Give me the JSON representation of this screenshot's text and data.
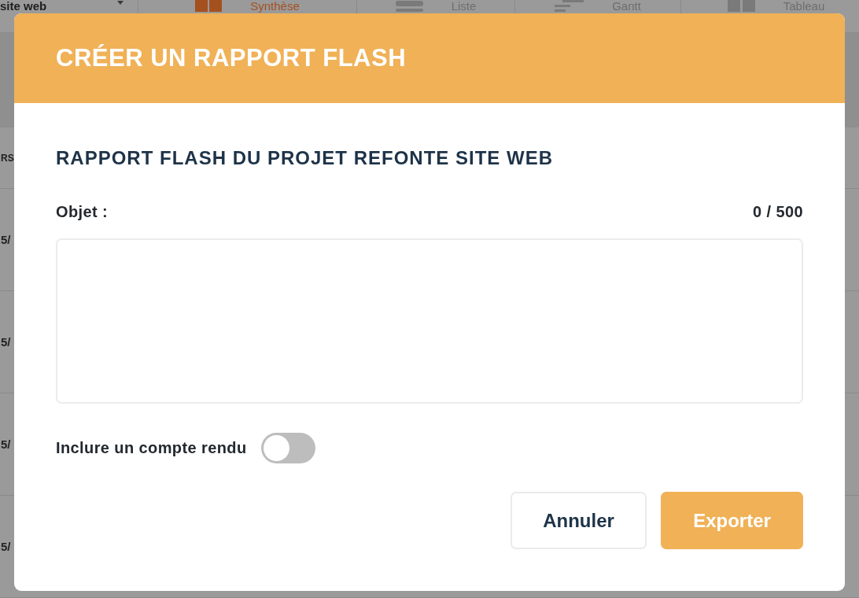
{
  "background": {
    "project_selector": {
      "value": "site web"
    },
    "views": [
      {
        "label": "Synthèse",
        "kind": "synthesis",
        "selected": true
      },
      {
        "label": "Liste",
        "kind": "list",
        "selected": false
      },
      {
        "label": "Gantt",
        "kind": "gantt",
        "selected": false
      },
      {
        "label": "Tableau",
        "kind": "board",
        "selected": false
      }
    ],
    "table": {
      "columns": [
        "RS"
      ],
      "rows": [
        {
          "column_1": "5/"
        },
        {
          "column_1": "5/"
        },
        {
          "column_1": "5/"
        },
        {
          "column_1": "5/"
        }
      ]
    }
  },
  "dialog": {
    "title": "CRÉER UN RAPPORT FLASH",
    "subtitle": "RAPPORT FLASH DU PROJET REFONTE SITE WEB",
    "field": {
      "label": "Objet :",
      "counter": "0 / 500"
    },
    "toggle": {
      "label": "Inclure un compte rendu",
      "on": false
    },
    "buttons": [
      {
        "label": "Annuler",
        "kind": "secondary"
      },
      {
        "label": "Exporter",
        "kind": "primary"
      }
    ]
  }
}
